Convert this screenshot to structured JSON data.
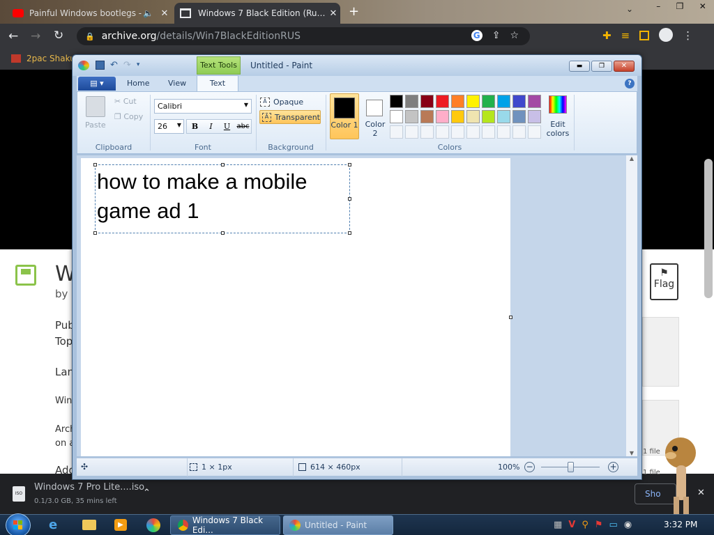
{
  "browser": {
    "tabs": [
      {
        "title": "Painful Windows bootlegs -",
        "active": false
      },
      {
        "title": "Windows 7 Black Edition (Russian",
        "active": true
      }
    ],
    "url": "archive.org/details/Win7BlackEditionRUS",
    "url_host": "archive.org",
    "url_path": "/details/Win7BlackEditionRUS",
    "bookmark": "2pac Shakur"
  },
  "page": {
    "title_partial": "W",
    "by_partial": "by",
    "lines": [
      "Pub",
      "Top",
      "Lan",
      "Win",
      "Arch",
      "on a",
      "Add"
    ],
    "flag_label": "Flag",
    "right_items": [
      "1 file",
      "1 file"
    ],
    "show_partial": "Sho"
  },
  "download": {
    "filename": "Windows 7 Pro Lite....iso",
    "progress": "0.1/3.0 GB, 35 mins left",
    "progress_fraction": 0.033
  },
  "taskbar": {
    "items": [
      {
        "label": "Windows 7 Black Edi...",
        "app": "chrome"
      },
      {
        "label": "Untitled - Paint",
        "app": "paint"
      }
    ],
    "clock": "3:32 PM"
  },
  "paint": {
    "contextual_tab": "Text Tools",
    "window_title": "Untitled - Paint",
    "tabs": [
      "Home",
      "View",
      "Text"
    ],
    "active_tab": "Text",
    "clipboard": {
      "paste": "Paste",
      "cut": "Cut",
      "copy": "Copy",
      "group": "Clipboard"
    },
    "font": {
      "family": "Calibri",
      "size": "26",
      "group": "Font",
      "bold": "B",
      "italic": "I",
      "underline": "U",
      "strike": "abc"
    },
    "background": {
      "opaque": "Opaque",
      "transparent": "Transparent",
      "group": "Background"
    },
    "colors": {
      "color1": "Color 1",
      "color2": "Color 2",
      "edit": "Edit colors",
      "group": "Colors",
      "color1_value": "#000000",
      "color2_value": "#ffffff",
      "palette_row1": [
        "#000000",
        "#7f7f7f",
        "#880015",
        "#ed1c24",
        "#ff7f27",
        "#fff200",
        "#22b14c",
        "#00a2e8",
        "#3f48cc",
        "#a349a4"
      ],
      "palette_row2": [
        "#ffffff",
        "#c3c3c3",
        "#b97a57",
        "#ffaec9",
        "#ffc90e",
        "#efe4b0",
        "#b5e61d",
        "#99d9ea",
        "#7092be",
        "#c8bfe7"
      ]
    },
    "canvas_text_line1": "how to make a mobile",
    "canvas_text_line2": "game ad 1",
    "status": {
      "selection": "1 × 1px",
      "size": "614 × 460px",
      "zoom": "100%"
    }
  }
}
